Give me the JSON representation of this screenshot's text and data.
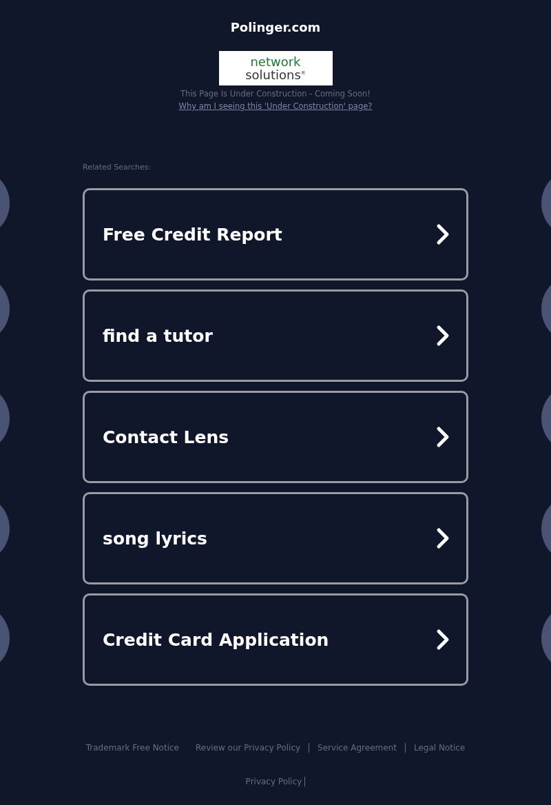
{
  "header": {
    "title": "Polinger.com",
    "logo": {
      "line_1": "network",
      "line_2": "solutions",
      "mark": "®"
    },
    "notice": "This Page Is Under Construction - Coming Soon!",
    "notice_link": "Why am I seeing this 'Under Construction' page?"
  },
  "related": {
    "heading": "Related Searches:",
    "items": [
      {
        "label": "Free Credit Report"
      },
      {
        "label": "find a tutor"
      },
      {
        "label": "Contact Lens"
      },
      {
        "label": "song lyrics"
      },
      {
        "label": "Credit Card Application"
      }
    ]
  },
  "footer": {
    "links": [
      {
        "label": "Trademark Free Notice",
        "divider": false
      },
      {
        "label": "Review our Privacy Policy",
        "divider": true
      },
      {
        "label": "Service Agreement",
        "divider": true
      },
      {
        "label": "Legal Notice",
        "divider": false
      }
    ],
    "bottom_links": [
      {
        "label": "Privacy Policy",
        "divider": true
      }
    ]
  }
}
